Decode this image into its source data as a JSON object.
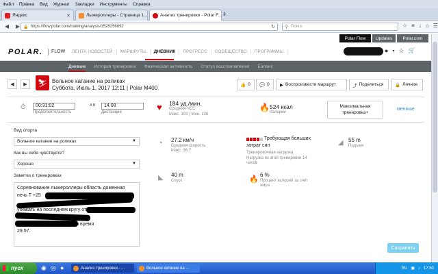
{
  "browser": {
    "menu": [
      "Файл",
      "Правка",
      "Вид",
      "Журнал",
      "Закладки",
      "Инструменты",
      "Справка"
    ],
    "tabs": [
      {
        "label": "Яндекс",
        "color": "#e51c23"
      },
      {
        "label": "Лыжероллеры - Страница 1...",
        "color": "#f2902c"
      },
      {
        "label": "Анализ тренировки - Polar F...",
        "color": "#d10a11"
      }
    ],
    "url": "https://flow.polar.com/training/analysis/1528256892",
    "search_placeholder": "Поиск"
  },
  "polar": {
    "top_links": [
      "Polar Flow",
      "Updates",
      "Polar.com"
    ],
    "logo": "POLAR.",
    "flow": "FLOW",
    "main_nav": [
      "ЛЕНТА НОВОСТЕЙ",
      "МАРШРУТЫ",
      "ДНЕВНИК",
      "ПРОГРЕСС",
      "СООБЩЕСТВО",
      "ПРОГРАММЫ"
    ],
    "sub_nav": [
      "Дневник",
      "История тренировок",
      "Физическая активность",
      "Статус восстановления",
      "Баланс"
    ]
  },
  "session": {
    "title": "Вольное катание на роликах",
    "subtitle": "Суббота, Июль 1, 2017 12:11 | Polar M400",
    "likes": "0",
    "comments": "0",
    "replay_label": "Воспроизвести маршрут",
    "share_label": "Поделиться",
    "private_label": "Личное"
  },
  "summary": {
    "duration_value": "00:31:02",
    "duration_label": "Продолжительность",
    "ab_label": "A  B",
    "distance_value": "14.08",
    "distance_label": "Дистанция",
    "hr_value": "184 уд./мин.",
    "hr_label": "Средняя ЧСС",
    "hr_minmax": "Макс. 193  |  Мин. 136",
    "calories_value": "524 ккал",
    "calories_label": "Калории",
    "target_label": "Максимальная тренировка+",
    "less_label": "меньше"
  },
  "form": {
    "sport_label": "Вид спорта",
    "sport_value": "Вольное катание на роликах",
    "feeling_label": "Как вы себя чувствуете?",
    "feeling_value": "Хорошо",
    "notes_label": "Заметки о тренировках",
    "notes_lines": [
      "Соревнование лыжероллеры область доменная",
      "печь Т +25",
      "",
      "убежать на последнем кругу от",
      "                    Я накатил",
      "                    Гонкой доволен время",
      "29.57."
    ]
  },
  "metrics": {
    "speed_value": "27.2 км/ч",
    "speed_label": "Средняя скорость",
    "speed_max": "Макс. 36.7",
    "load_line1": "Требующая больших",
    "load_line2": "затрат сил",
    "load_label": "Тренировочная нагрузка",
    "load_recovery": "Нагрузка из этой тренировки 14",
    "load_recovery2": "часов",
    "ascent_value": "55 m",
    "ascent_label": "Подъем",
    "descent_value": "40 m",
    "descent_label": "Спуск",
    "fat_value": "6 %",
    "fat_label": "Процент калорий за счет",
    "fat_label2": "жира",
    "save_label": "Сохранить"
  },
  "taskbar": {
    "start": "пуск",
    "item1": "Анализ тренировки - ...",
    "item2": "Вольное катание на ...",
    "lang": "RU",
    "time": "17:53"
  },
  "colors": {
    "polar_red": "#d10a11",
    "link_blue": "#3a8fd8",
    "save_blue": "#7fd1f2",
    "subnav_gray": "#5d6468"
  }
}
